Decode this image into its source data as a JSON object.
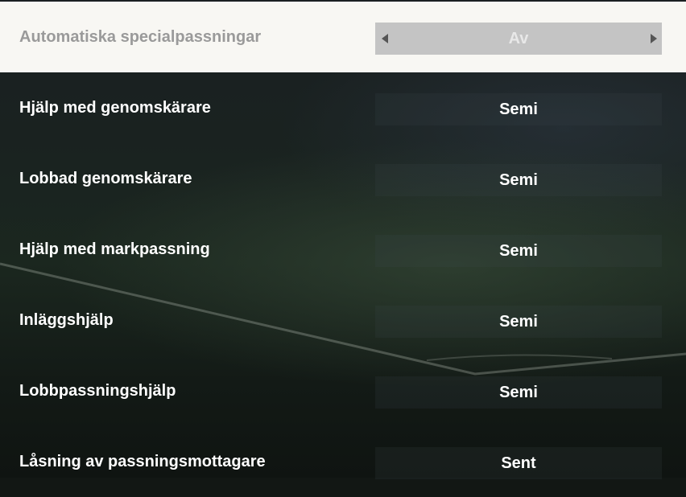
{
  "settings": [
    {
      "label": "Automatiska specialpassningar",
      "value": "Av",
      "selected": true
    },
    {
      "label": "Hjälp med genomskärare",
      "value": "Semi",
      "selected": false
    },
    {
      "label": "Lobbad genomskärare",
      "value": "Semi",
      "selected": false
    },
    {
      "label": "Hjälp med markpassning",
      "value": "Semi",
      "selected": false
    },
    {
      "label": "Inläggshjälp",
      "value": "Semi",
      "selected": false
    },
    {
      "label": "Lobbpassningshjälp",
      "value": "Semi",
      "selected": false
    },
    {
      "label": "Låsning av passningsmottagare",
      "value": "Sent",
      "selected": false
    }
  ],
  "colors": {
    "selected_row_bg": "#f8f7f3",
    "selected_value_box": "#c4c4c4",
    "text": "#ffffff",
    "selected_label_text": "#9a9a9a"
  },
  "icons": {
    "prev": "caret-left-icon",
    "next": "caret-right-icon"
  }
}
